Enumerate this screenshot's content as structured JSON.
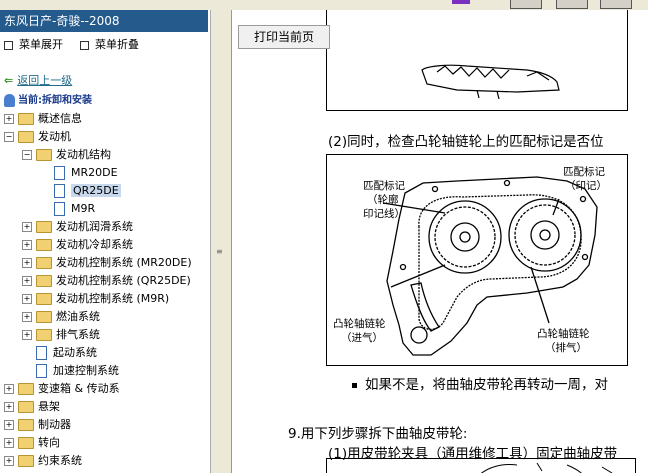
{
  "window": {
    "title": "东风日产-奇骏--2008"
  },
  "menu": {
    "expand_label": "菜单展开",
    "collapse_label": "菜单折叠"
  },
  "nav": {
    "back_label": "返回上一级",
    "current_label": "当前:拆卸和安装"
  },
  "tree": [
    {
      "label": "概述信息",
      "level": 0,
      "state": "+",
      "type": "folder"
    },
    {
      "label": "发动机",
      "level": 0,
      "state": "-",
      "type": "folder"
    },
    {
      "label": "发动机结构",
      "level": 1,
      "state": "-",
      "type": "folder"
    },
    {
      "label": "MR20DE",
      "level": 2,
      "state": "",
      "type": "doc"
    },
    {
      "label": "QR25DE",
      "level": 2,
      "state": "",
      "type": "doc",
      "selected": true
    },
    {
      "label": "M9R",
      "level": 2,
      "state": "",
      "type": "doc"
    },
    {
      "label": "发动机润滑系统",
      "level": 1,
      "state": "+",
      "type": "folder"
    },
    {
      "label": "发动机冷却系统",
      "level": 1,
      "state": "+",
      "type": "folder"
    },
    {
      "label": "发动机控制系统 (MR20DE)",
      "level": 1,
      "state": "+",
      "type": "folder"
    },
    {
      "label": "发动机控制系统 (QR25DE)",
      "level": 1,
      "state": "+",
      "type": "folder"
    },
    {
      "label": "发动机控制系统 (M9R)",
      "level": 1,
      "state": "+",
      "type": "folder"
    },
    {
      "label": "燃油系统",
      "level": 1,
      "state": "+",
      "type": "folder"
    },
    {
      "label": "排气系统",
      "level": 1,
      "state": "+",
      "type": "folder"
    },
    {
      "label": "起动系统",
      "level": 1,
      "state": "",
      "type": "doc"
    },
    {
      "label": "加速控制系统",
      "level": 1,
      "state": "",
      "type": "doc"
    },
    {
      "label": "变速箱 & 传动系",
      "level": 0,
      "state": "+",
      "type": "folder"
    },
    {
      "label": "悬架",
      "level": 0,
      "state": "+",
      "type": "folder"
    },
    {
      "label": "制动器",
      "level": 0,
      "state": "+",
      "type": "folder"
    },
    {
      "label": "转向",
      "level": 0,
      "state": "+",
      "type": "folder"
    },
    {
      "label": "约束系统",
      "level": 0,
      "state": "+",
      "type": "folder"
    }
  ],
  "content": {
    "print_label": "打印当前页",
    "step2_text": "(2)同时，检查凸轮轴链轮上的匹配标记是否位",
    "figure": {
      "label_match_outline": [
        "匹配标记",
        "（轮廓",
        "印记线）"
      ],
      "label_match_print": [
        "匹配标记",
        "（印记）"
      ],
      "label_intake": [
        "凸轮轴链轮",
        "（进气）"
      ],
      "label_exhaust": [
        "凸轮轴链轮",
        "（排气）"
      ]
    },
    "bullet_text": "如果不是，将曲轴皮带轮再转动一周，对",
    "step9_text": "9.用下列步骤拆下曲轴皮带轮:",
    "step9_1_text": "(1)用皮带轮夹具（通用维修工具）固定曲轴皮带"
  },
  "colors": {
    "title_bg": "#245a8c",
    "selected_bg": "#c8d8ec",
    "back_link": "#1f6b8a",
    "current_text": "#1a3a8a"
  }
}
